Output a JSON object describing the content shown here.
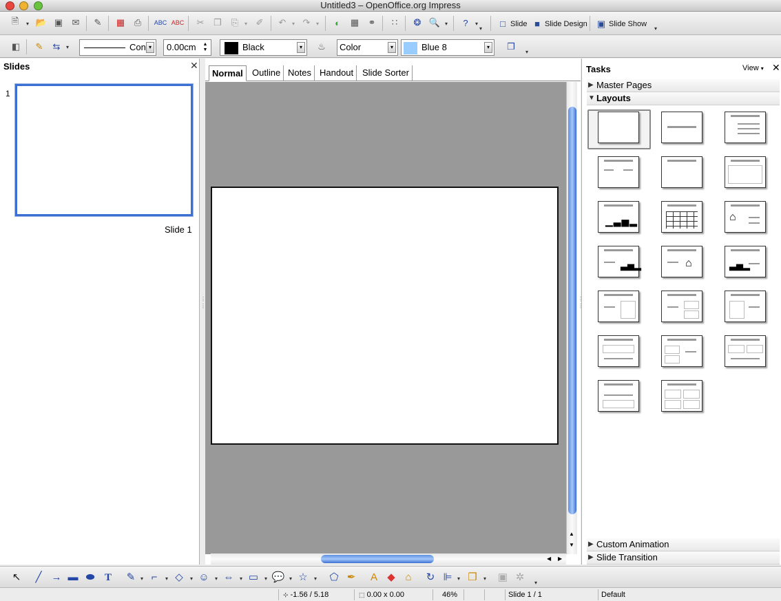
{
  "window": {
    "title": "Untitled3 – OpenOffice.org Impress"
  },
  "toolbar_main": {
    "slide_label": "Slide",
    "slide_design_label": "Slide Design",
    "slide_show_label": "Slide Show"
  },
  "toolbar_line": {
    "line_style": "Con",
    "line_width": "0.00cm",
    "line_color": "Black",
    "line_color_hex": "#000000",
    "area_style": "Color",
    "area_color": "Blue 8",
    "area_color_hex": "#99ccff"
  },
  "slides_pane": {
    "title": "Slides",
    "slide_number": "1",
    "slide_name": "Slide 1"
  },
  "view_tabs": [
    "Normal",
    "Outline",
    "Notes",
    "Handout",
    "Slide Sorter"
  ],
  "tasks_pane": {
    "title": "Tasks",
    "view_label": "View",
    "sections": {
      "master_pages": "Master Pages",
      "layouts": "Layouts",
      "custom_animation": "Custom Animation",
      "slide_transition": "Slide Transition"
    },
    "layout_count": 20
  },
  "status": {
    "position": "-1.56 / 5.18",
    "size": "0.00 x 0.00",
    "zoom": "46%",
    "slide": "Slide 1 / 1",
    "master": "Default"
  },
  "accent_color": "#3b6fd1"
}
